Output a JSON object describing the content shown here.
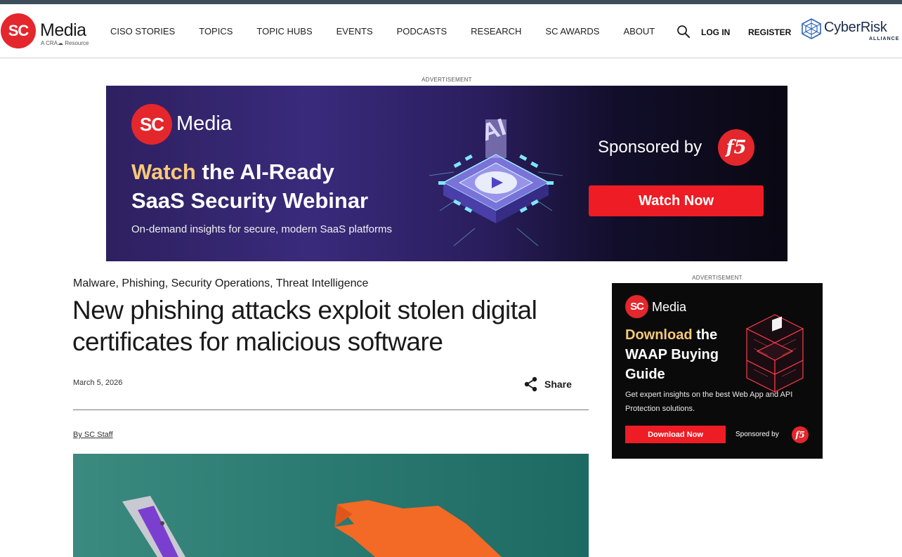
{
  "header": {
    "logo": {
      "mark": "SC",
      "word": "Media",
      "sub": "A CRA☁ Resource"
    },
    "nav": [
      "CISO STORIES",
      "TOPICS",
      "TOPIC HUBS",
      "EVENTS",
      "PODCASTS",
      "RESEARCH",
      "SC AWARDS",
      "ABOUT"
    ],
    "login_label": "LOG IN",
    "register_label": "REGISTER",
    "partner_logo": {
      "name": "CyberRisk",
      "sub": "ALLIANCE"
    }
  },
  "top_ad": {
    "label": "ADVERTISEMENT",
    "logo_mark": "SC",
    "logo_word": "Media",
    "headline_highlight": "Watch",
    "headline_rest_line1": " the AI-Ready",
    "headline_line2": "SaaS Security Webinar",
    "subtext": "On-demand insights for secure, modern SaaS platforms",
    "sponsor_text": "Sponsored by",
    "sponsor_logo": "f5",
    "cta_label": "Watch Now",
    "chip_letters": "AI"
  },
  "article": {
    "tags": [
      "Malware",
      "Phishing",
      "Security Operations",
      "Threat Intelligence"
    ],
    "title": "New phishing attacks exploit stolen digital certificates for malicious software",
    "date": "March 5, 2026",
    "share_label": "Share",
    "byline": "By SC Staff"
  },
  "side_ad": {
    "label": "ADVERTISEMENT",
    "logo_mark": "SC",
    "logo_word": "Media",
    "headline_highlight": "Download",
    "headline_rest": " the WAAP Buying Guide",
    "subtext": "Get expert insights on the best Web App and API Protection solutions.",
    "cta_label": "Download Now",
    "sponsor_text": "Sponsored by",
    "sponsor_logo": "f5"
  },
  "colors": {
    "brand_red": "#e4262d",
    "highlight_gold": "#f7c879",
    "nav_text": "#222222"
  },
  "icons": [
    "search-icon",
    "share-icon",
    "cyberrisk-logo-icon",
    "chip-illustration",
    "cube-illustration"
  ]
}
